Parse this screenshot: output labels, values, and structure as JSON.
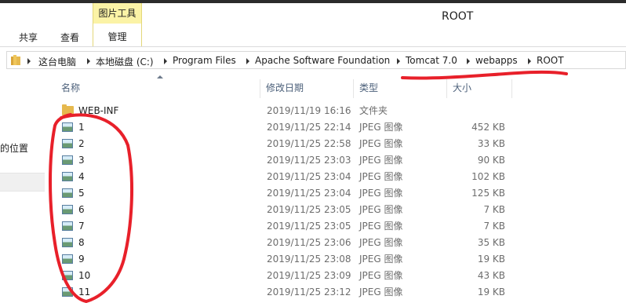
{
  "window": {
    "title": "ROOT",
    "context_tab": "图片工具"
  },
  "ribbon": {
    "tabs": [
      {
        "label": "共享"
      },
      {
        "label": "查看"
      },
      {
        "label": "管理"
      }
    ]
  },
  "address": {
    "crumbs": [
      {
        "label": "这台电脑"
      },
      {
        "label": "本地磁盘 (C:)"
      },
      {
        "label": "Program Files"
      },
      {
        "label": "Apache Software Foundation"
      },
      {
        "label": "Tomcat 7.0"
      },
      {
        "label": "webapps"
      },
      {
        "label": "ROOT"
      }
    ]
  },
  "left_pane": {
    "partial_label": "的位置"
  },
  "columns": {
    "name": "名称",
    "date": "修改日期",
    "type": "类型",
    "size": "大小"
  },
  "files": [
    {
      "name": "WEB-INF",
      "date": "2019/11/19 16:16",
      "type": "文件夹",
      "size": "",
      "icon": "folder-icon"
    },
    {
      "name": "1",
      "date": "2019/11/25 22:14",
      "type": "JPEG 图像",
      "size": "452 KB",
      "icon": "image-icon"
    },
    {
      "name": "2",
      "date": "2019/11/25 22:58",
      "type": "JPEG 图像",
      "size": "33 KB",
      "icon": "image-icon"
    },
    {
      "name": "3",
      "date": "2019/11/25 23:03",
      "type": "JPEG 图像",
      "size": "90 KB",
      "icon": "image-icon"
    },
    {
      "name": "4",
      "date": "2019/11/25 23:04",
      "type": "JPEG 图像",
      "size": "102 KB",
      "icon": "image-icon"
    },
    {
      "name": "5",
      "date": "2019/11/25 23:04",
      "type": "JPEG 图像",
      "size": "125 KB",
      "icon": "image-icon"
    },
    {
      "name": "6",
      "date": "2019/11/25 23:05",
      "type": "JPEG 图像",
      "size": "7 KB",
      "icon": "image-icon"
    },
    {
      "name": "7",
      "date": "2019/11/25 23:05",
      "type": "JPEG 图像",
      "size": "7 KB",
      "icon": "image-icon"
    },
    {
      "name": "8",
      "date": "2019/11/25 23:06",
      "type": "JPEG 图像",
      "size": "35 KB",
      "icon": "image-icon"
    },
    {
      "name": "9",
      "date": "2019/11/25 23:08",
      "type": "JPEG 图像",
      "size": "19 KB",
      "icon": "image-icon"
    },
    {
      "name": "10",
      "date": "2019/11/25 23:09",
      "type": "JPEG 图像",
      "size": "43 KB",
      "icon": "image-icon"
    },
    {
      "name": "11",
      "date": "2019/11/25 23:12",
      "type": "JPEG 图像",
      "size": "19 KB",
      "icon": "image-icon"
    }
  ],
  "colors": {
    "annotation": "#e8202a",
    "context_tab_bg": "#fbf3a6",
    "header_text": "#4c607a"
  }
}
